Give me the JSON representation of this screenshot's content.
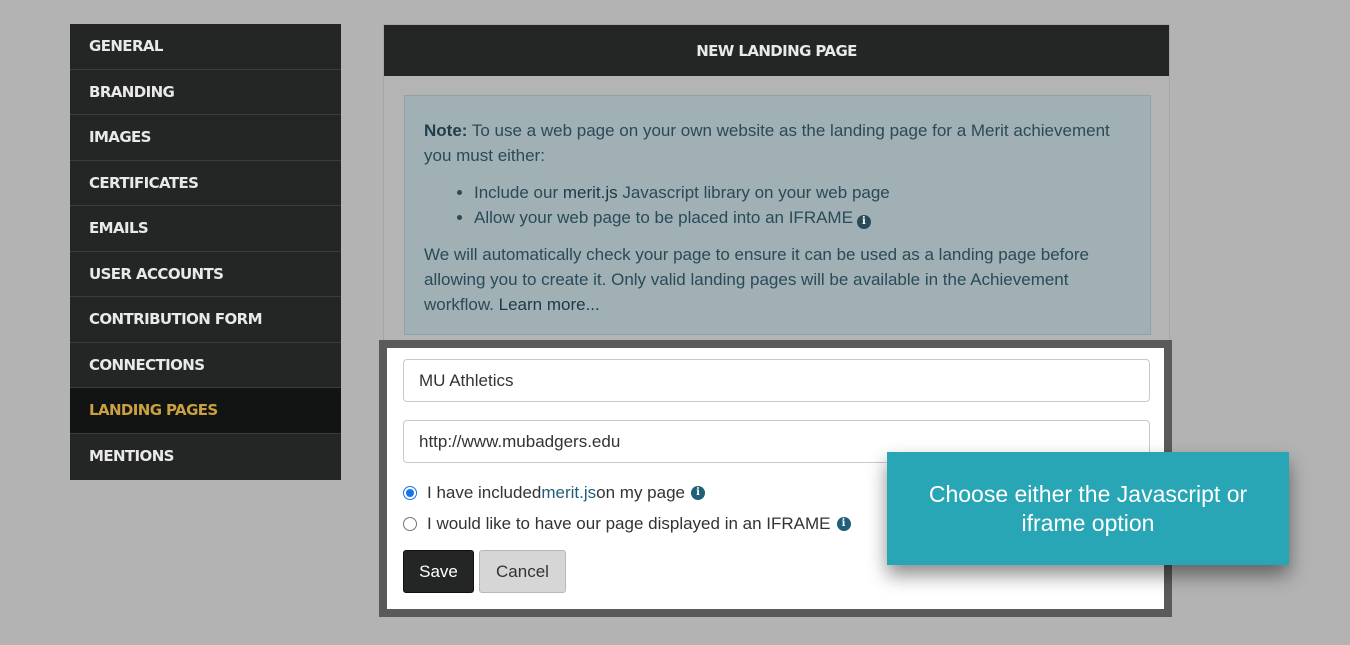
{
  "sidebar": {
    "items": [
      {
        "label": "GENERAL"
      },
      {
        "label": "BRANDING"
      },
      {
        "label": "IMAGES"
      },
      {
        "label": "CERTIFICATES"
      },
      {
        "label": "EMAILS"
      },
      {
        "label": "USER ACCOUNTS"
      },
      {
        "label": "CONTRIBUTION FORM"
      },
      {
        "label": "CONNECTIONS"
      },
      {
        "label": "LANDING PAGES",
        "active": true
      },
      {
        "label": "MENTIONS"
      }
    ]
  },
  "panel": {
    "title": "NEW LANDING PAGE",
    "note": {
      "label": "Note:",
      "intro": " To use a web page on your own website as the landing page for a Merit achievement you must either:",
      "bullets": {
        "b1_pre": "Include our ",
        "b1_link": "merit.js",
        "b1_post": " Javascript library on your web page",
        "b2": "Allow your web page to be placed into an IFRAME"
      },
      "body": "We will automatically check your page to ensure it can be used as a landing page before allowing you to create it. Only valid landing pages will be available in the Achievement workflow. ",
      "learn_more": "Learn more..."
    }
  },
  "form": {
    "name_value": "MU Athletics",
    "url_value": "http://www.mubadgers.edu",
    "radio_js": {
      "pre": "I have included ",
      "link": "merit.js",
      "post": " on my page",
      "checked": true
    },
    "radio_iframe": {
      "label": "I would like to have our page displayed in an IFRAME",
      "checked": false
    },
    "save_label": "Save",
    "cancel_label": "Cancel"
  },
  "callout": {
    "text": "Choose either the Javascript or iframe option",
    "color": "#28a6b5"
  },
  "colors": {
    "sidebar_bg": "#232624",
    "active_item": "#c9a140",
    "note_bg": "#a0b0b5"
  },
  "icons": {
    "info": "info-circle-icon"
  }
}
